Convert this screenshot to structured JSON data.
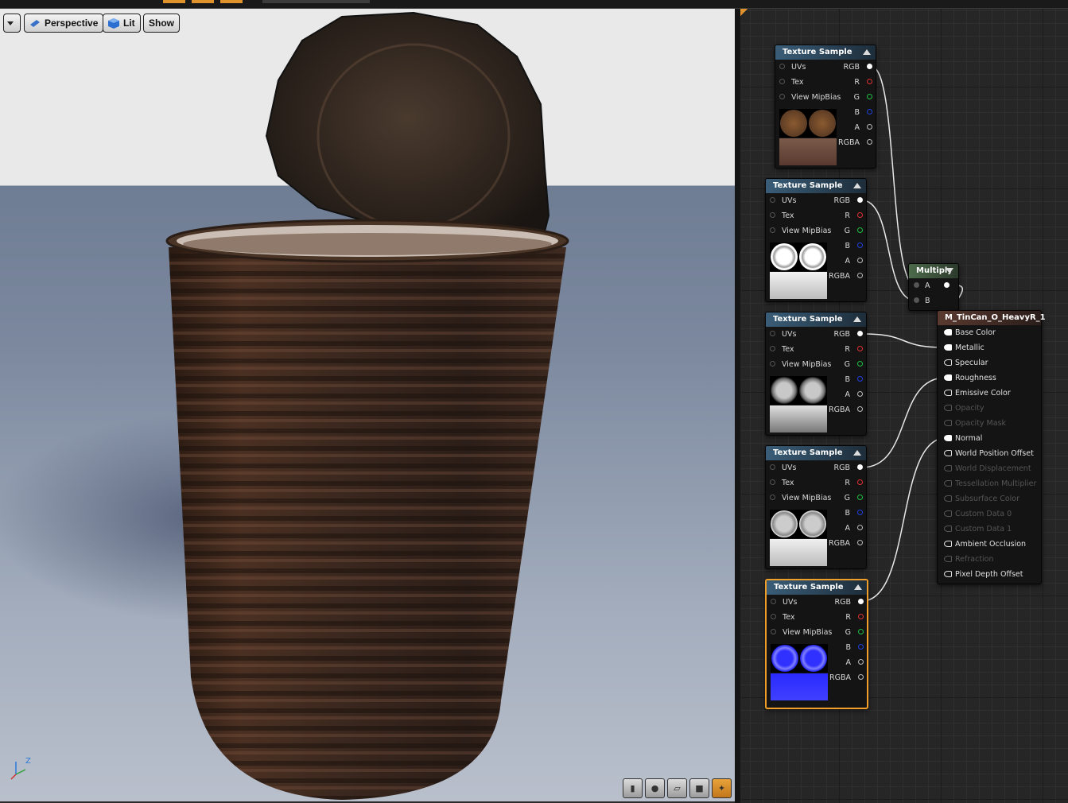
{
  "viewport": {
    "toolbar": {
      "menu_label": "",
      "perspective_label": "Perspective",
      "lit_label": "Lit",
      "show_label": "Show"
    },
    "axis": {
      "z": "Z"
    },
    "bottom_tools": [
      "cylinder-preview-icon",
      "sphere-preview-icon",
      "plane-preview-icon",
      "cube-preview-icon",
      "custom-mesh-preview-icon"
    ]
  },
  "colors": {
    "accent": "#f0a028",
    "node_header": "#3a5d78",
    "multiply_header": "#4c6a4a",
    "result_header": "#5a3a30",
    "pin_red": "#e03030",
    "pin_green": "#20c040",
    "pin_blue": "#2040e0"
  },
  "graph": {
    "texture_nodes": [
      {
        "title": "Texture Sample",
        "inputs": [
          "UVs",
          "Tex",
          "View MipBias"
        ],
        "outputs": [
          "RGB",
          "R",
          "G",
          "B",
          "A",
          "RGBA"
        ],
        "preview": "rust-diffuse"
      },
      {
        "title": "Texture Sample",
        "inputs": [
          "UVs",
          "Tex",
          "View MipBias"
        ],
        "outputs": [
          "RGB",
          "R",
          "G",
          "B",
          "A",
          "RGBA"
        ],
        "preview": "ao-mask"
      },
      {
        "title": "Texture Sample",
        "inputs": [
          "UVs",
          "Tex",
          "View MipBias"
        ],
        "outputs": [
          "RGB",
          "R",
          "G",
          "B",
          "A",
          "RGBA"
        ],
        "preview": "metallic-mask"
      },
      {
        "title": "Texture Sample",
        "inputs": [
          "UVs",
          "Tex",
          "View MipBias"
        ],
        "outputs": [
          "RGB",
          "R",
          "G",
          "B",
          "A",
          "RGBA"
        ],
        "preview": "roughness-mask"
      },
      {
        "title": "Texture Sample",
        "inputs": [
          "UVs",
          "Tex",
          "View MipBias"
        ],
        "outputs": [
          "RGB",
          "R",
          "G",
          "B",
          "A",
          "RGBA"
        ],
        "preview": "normal-map"
      }
    ],
    "multiply": {
      "title": "Multiply",
      "inputs": [
        "A",
        "B"
      ]
    },
    "result": {
      "title": "M_TinCan_O_HeavyR_1",
      "pins": [
        {
          "label": "Base Color",
          "enabled": true,
          "connected": true
        },
        {
          "label": "Metallic",
          "enabled": true,
          "connected": true
        },
        {
          "label": "Specular",
          "enabled": true,
          "connected": false
        },
        {
          "label": "Roughness",
          "enabled": true,
          "connected": true
        },
        {
          "label": "Emissive Color",
          "enabled": true,
          "connected": false
        },
        {
          "label": "Opacity",
          "enabled": false,
          "connected": false
        },
        {
          "label": "Opacity Mask",
          "enabled": false,
          "connected": false
        },
        {
          "label": "Normal",
          "enabled": true,
          "connected": true
        },
        {
          "label": "World Position Offset",
          "enabled": true,
          "connected": false
        },
        {
          "label": "World Displacement",
          "enabled": false,
          "connected": false
        },
        {
          "label": "Tessellation Multiplier",
          "enabled": false,
          "connected": false
        },
        {
          "label": "Subsurface Color",
          "enabled": false,
          "connected": false
        },
        {
          "label": "Custom Data 0",
          "enabled": false,
          "connected": false
        },
        {
          "label": "Custom Data 1",
          "enabled": false,
          "connected": false
        },
        {
          "label": "Ambient Occlusion",
          "enabled": true,
          "connected": false
        },
        {
          "label": "Refraction",
          "enabled": false,
          "connected": false
        },
        {
          "label": "Pixel Depth Offset",
          "enabled": true,
          "connected": false
        }
      ]
    }
  }
}
